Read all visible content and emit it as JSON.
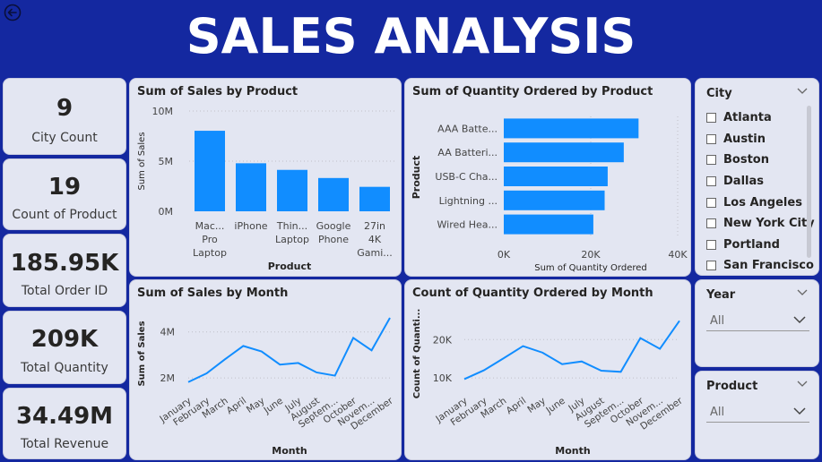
{
  "header": {
    "title": "SALES ANALYSIS",
    "back_icon": "back-arrow-icon"
  },
  "kpis": [
    {
      "value": "9",
      "label": "City Count"
    },
    {
      "value": "19",
      "label": "Count of Product"
    },
    {
      "value": "185.95K",
      "label": "Total Order ID"
    },
    {
      "value": "209K",
      "label": "Total Quantity"
    },
    {
      "value": "34.49M",
      "label": "Total Revenue"
    }
  ],
  "slicers": {
    "city": {
      "title": "City",
      "items": [
        "Atlanta",
        "Austin",
        "Boston",
        "Dallas",
        "Los Angeles",
        "New York City",
        "Portland",
        "San Francisco"
      ]
    },
    "year": {
      "title": "Year",
      "value": "All"
    },
    "product": {
      "title": "Product",
      "value": "All"
    }
  },
  "colors": {
    "accent": "#118dff",
    "background": "#1428a0",
    "card": "#e3e6f2"
  },
  "chart_data": [
    {
      "type": "bar",
      "title": "Sum of Sales by Product",
      "xlabel": "Product",
      "ylabel": "Sum of Sales",
      "ylim": [
        0,
        10000000
      ],
      "yticks": [
        "0M",
        "5M",
        "10M"
      ],
      "categories": [
        [
          "Mac...",
          "Pro",
          "Laptop"
        ],
        [
          "iPhone"
        ],
        [
          "Thin...",
          "Laptop"
        ],
        [
          "Google",
          "Phone"
        ],
        [
          "27in",
          "4K",
          "Gami..."
        ]
      ],
      "values": [
        8030000,
        4790000,
        4130000,
        3320000,
        2440000
      ]
    },
    {
      "type": "bar",
      "orientation": "horizontal",
      "title": "Sum of Quantity Ordered by Product",
      "xlabel": "Sum of Quantity Ordered",
      "ylabel": "Product",
      "xlim": [
        0,
        40000
      ],
      "xticks": [
        "0K",
        "20K",
        "40K"
      ],
      "categories": [
        "AAA Batte...",
        "AA Batteri...",
        "USB-C Cha...",
        "Lightning ...",
        "Wired Hea..."
      ],
      "values": [
        31000,
        27600,
        23900,
        23200,
        20600
      ]
    },
    {
      "type": "line",
      "title": "Sum of Sales by Month",
      "xlabel": "Month",
      "ylabel": "Sum of Sales",
      "ylim": [
        1500000,
        5000000
      ],
      "yticks": [
        {
          "v": 2000000,
          "label": "2M"
        },
        {
          "v": 4000000,
          "label": "4M"
        }
      ],
      "categories": [
        "January",
        "February",
        "March",
        "April",
        "May",
        "June",
        "July",
        "August",
        "Septem...",
        "October",
        "Novem...",
        "December"
      ],
      "values": [
        1820000,
        2200000,
        2810000,
        3390000,
        3150000,
        2580000,
        2650000,
        2240000,
        2100000,
        3740000,
        3200000,
        4610000
      ]
    },
    {
      "type": "line",
      "title": "Count of Quantity Ordered by Month",
      "xlabel": "Month",
      "ylabel": "Count of Quanti...",
      "ylim": [
        7000,
        28000
      ],
      "yticks": [
        {
          "v": 10000,
          "label": "10K"
        },
        {
          "v": 20000,
          "label": "20K"
        }
      ],
      "categories": [
        "January",
        "February",
        "March",
        "April",
        "May",
        "June",
        "July",
        "August",
        "Septem...",
        "October",
        "Novem...",
        "December"
      ],
      "values": [
        9700,
        12000,
        15100,
        18300,
        16600,
        13600,
        14300,
        11900,
        11600,
        20400,
        17600,
        24900
      ]
    }
  ]
}
